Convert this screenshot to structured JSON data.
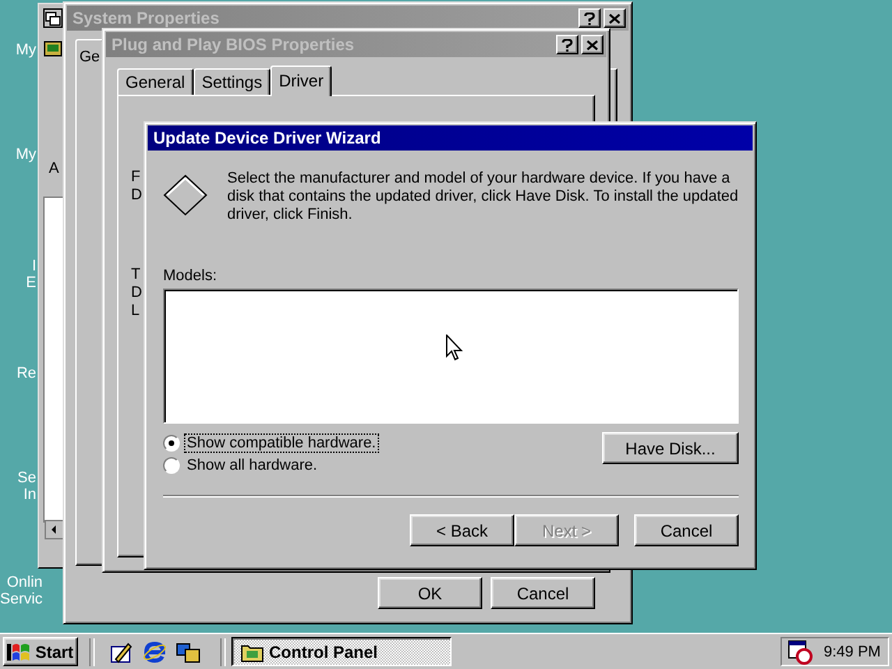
{
  "desktop_icons": [
    {
      "label": "My"
    },
    {
      "label": "My"
    },
    {
      "label": "I\nE"
    },
    {
      "label": "Re"
    },
    {
      "label": "Se\nIn"
    },
    {
      "label": "Onlin\nServic"
    }
  ],
  "back_window": {
    "fragment": "A"
  },
  "system_properties": {
    "title": "System Properties",
    "active": false,
    "tabs": [
      {
        "label": "Ge",
        "selected": true
      }
    ],
    "buttons": [
      "OK",
      "Cancel"
    ]
  },
  "pnp_properties": {
    "title": "Plug and Play BIOS Properties",
    "active": false,
    "tabs": [
      {
        "label": "General",
        "selected": false
      },
      {
        "label": "Settings",
        "selected": false
      },
      {
        "label": "Driver",
        "selected": true
      }
    ],
    "content_fragments": [
      {
        "lines": [
          "F",
          "D"
        ]
      },
      {
        "lines": [
          "T",
          "D",
          "L"
        ]
      }
    ]
  },
  "wizard": {
    "title": "Update Device Driver Wizard",
    "active": true,
    "instructions": "Select the manufacturer and model of your hardware device. If you have a disk that contains the updated driver, click Have Disk. To install the updated driver, click Finish.",
    "models_label": "Models:",
    "options": [
      {
        "label": "Show compatible hardware.",
        "selected": true
      },
      {
        "label": "Show all hardware.",
        "selected": false
      }
    ],
    "have_disk": "Have Disk...",
    "buttons": [
      {
        "label": "< Back",
        "disabled": false
      },
      {
        "label": "Next >",
        "disabled": true
      },
      {
        "label": "Cancel",
        "disabled": false
      }
    ]
  },
  "taskbar": {
    "start": "Start",
    "tasks": [
      {
        "label": "Control Panel",
        "selected": true
      }
    ],
    "clock": "9:49 PM"
  }
}
